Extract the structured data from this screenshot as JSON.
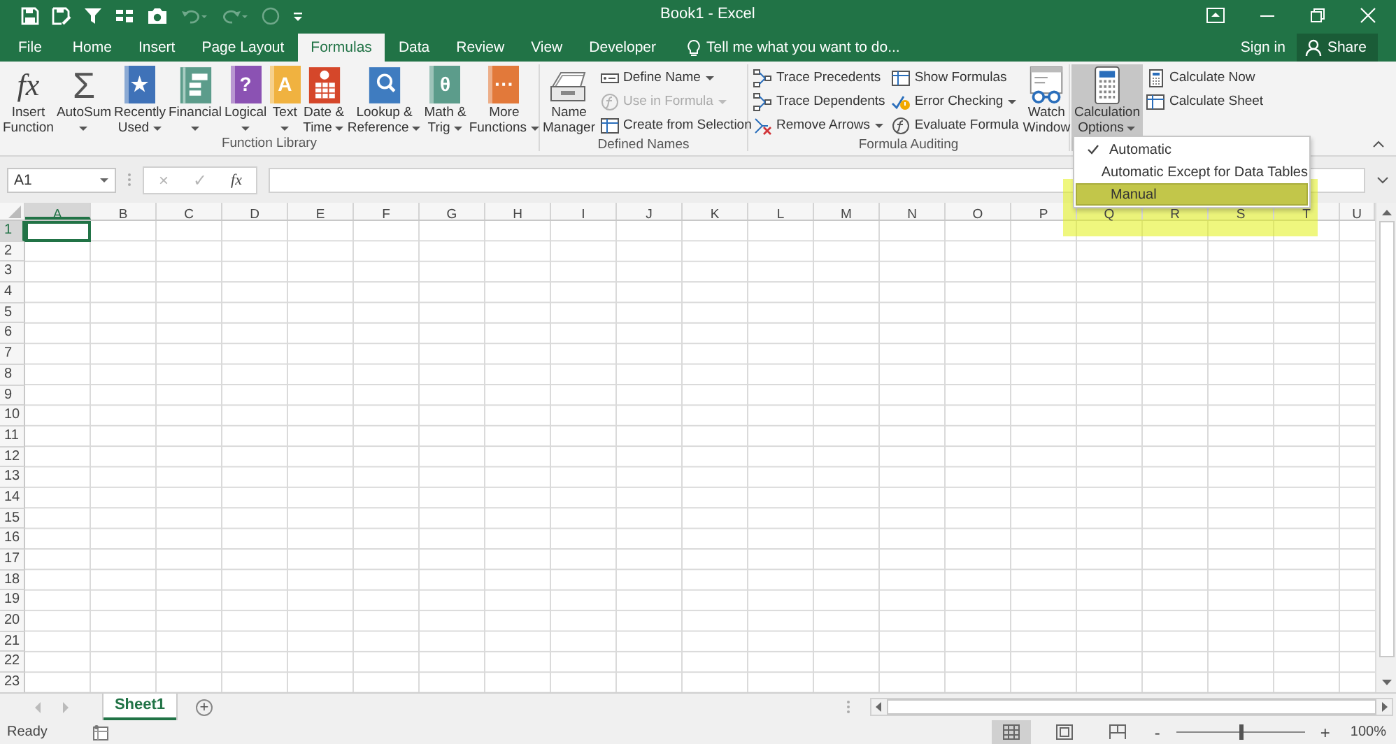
{
  "window": {
    "title": "Book1 - Excel"
  },
  "tabs": [
    {
      "label": "File",
      "selected": false
    },
    {
      "label": "Home",
      "selected": false
    },
    {
      "label": "Insert",
      "selected": false
    },
    {
      "label": "Page Layout",
      "selected": false
    },
    {
      "label": "Formulas",
      "selected": true
    },
    {
      "label": "Data",
      "selected": false
    },
    {
      "label": "Review",
      "selected": false
    },
    {
      "label": "View",
      "selected": false
    },
    {
      "label": "Developer",
      "selected": false
    }
  ],
  "tell_me": {
    "placeholder": "Tell me what you want to do..."
  },
  "sign_in": "Sign in",
  "share": "Share",
  "ribbon_groups": [
    {
      "label": "Function Library",
      "columns": [
        {
          "kind": "fx",
          "glyph": "fx",
          "lines": [
            "Insert",
            "Function"
          ],
          "dropdown": false,
          "pressed": false
        },
        {
          "kind": "sigma",
          "glyph": "Σ",
          "lines": [
            "AutoSum"
          ],
          "dropdown": true,
          "pressed": false
        },
        {
          "kind": "book",
          "glyph": "★",
          "color": "#3f72b8",
          "lines": [
            "Recently",
            "Used"
          ],
          "dropdown": true,
          "pressed": false
        },
        {
          "kind": "coins",
          "color": "#5c9c8b",
          "lines": [
            "Financial"
          ],
          "dropdown": true,
          "pressed": false
        },
        {
          "kind": "book",
          "glyph": "?",
          "color": "#8b52b3",
          "lines": [
            "Logical"
          ],
          "dropdown": true,
          "pressed": false
        },
        {
          "kind": "book",
          "glyph": "A",
          "color": "#f0b240",
          "lines": [
            "Text"
          ],
          "dropdown": true,
          "pressed": false
        },
        {
          "kind": "calendar",
          "color": "#d5472a",
          "lines": [
            "Date &",
            "Time"
          ],
          "dropdown": true,
          "pressed": false
        },
        {
          "kind": "lookup",
          "color": "#3f7cc0",
          "lines": [
            "Lookup &",
            "Reference"
          ],
          "dropdown": true,
          "pressed": false
        },
        {
          "kind": "book",
          "glyph": "θ",
          "color": "#5c9c8b",
          "lines": [
            "Math &",
            "Trig"
          ],
          "dropdown": true,
          "pressed": false
        },
        {
          "kind": "book",
          "glyph": "···",
          "color": "#e2793a",
          "lines": [
            "More",
            "Functions"
          ],
          "dropdown": true,
          "pressed": false
        }
      ]
    },
    {
      "label": "Defined Names",
      "columns": [
        {
          "kind": "name-manager",
          "lines": [
            "Name",
            "Manager"
          ],
          "dropdown": false,
          "pressed": false
        },
        {
          "items": [
            {
              "kind": "tag",
              "label": "Define Name",
              "dropdown": true,
              "disabled": false
            },
            {
              "kind": "fx-small",
              "label": "Use in Formula",
              "dropdown": true,
              "disabled": true
            },
            {
              "kind": "table",
              "label": "Create from Selection",
              "dropdown": false,
              "disabled": false
            }
          ]
        }
      ]
    },
    {
      "label": "Formula Auditing",
      "columns": [
        {
          "items": [
            {
              "kind": "precedents",
              "label": "Trace Precedents",
              "dropdown": false,
              "disabled": false
            },
            {
              "kind": "dependents",
              "label": "Trace Dependents",
              "dropdown": false,
              "disabled": false
            },
            {
              "kind": "remove-arrows",
              "label": "Remove Arrows",
              "dropdown": true,
              "disabled": false
            }
          ]
        },
        {
          "items": [
            {
              "kind": "show-formulas",
              "label": "Show Formulas",
              "dropdown": false,
              "disabled": false
            },
            {
              "kind": "error",
              "label": "Error Checking",
              "dropdown": true,
              "disabled": false
            },
            {
              "kind": "evaluate",
              "label": "Evaluate Formula",
              "dropdown": false,
              "disabled": false
            }
          ]
        },
        {
          "kind": "watch",
          "lines": [
            "Watch",
            "Window"
          ],
          "dropdown": false,
          "pressed": false
        }
      ]
    },
    {
      "columns": [
        {
          "kind": "calculator",
          "lines": [
            "Calculation",
            "Options"
          ],
          "dropdown": true,
          "pressed": true
        },
        {
          "items": [
            {
              "kind": "calc-now",
              "label": "Calculate Now",
              "dropdown": false,
              "disabled": false
            },
            {
              "kind": "calc-sheet",
              "label": "Calculate Sheet",
              "dropdown": false,
              "disabled": false
            }
          ]
        }
      ]
    }
  ],
  "calc_menu": [
    {
      "label": "Automatic",
      "checked": true,
      "selected": false
    },
    {
      "label": "Automatic Except for Data Tables",
      "checked": false,
      "selected": false
    },
    {
      "label": "Manual",
      "checked": false,
      "selected": true
    }
  ],
  "name_box": "A1",
  "formula_buttons": {
    "cancel": "×",
    "enter": "✓",
    "function": "fx"
  },
  "columns": [
    {
      "label": "A",
      "selected": true
    },
    {
      "label": "B",
      "selected": false
    },
    {
      "label": "C",
      "selected": false
    },
    {
      "label": "D",
      "selected": false
    },
    {
      "label": "E",
      "selected": false
    },
    {
      "label": "F",
      "selected": false
    },
    {
      "label": "G",
      "selected": false
    },
    {
      "label": "H",
      "selected": false
    },
    {
      "label": "I",
      "selected": false
    },
    {
      "label": "J",
      "selected": false
    },
    {
      "label": "K",
      "selected": false
    },
    {
      "label": "L",
      "selected": false
    },
    {
      "label": "M",
      "selected": false
    },
    {
      "label": "N",
      "selected": false
    },
    {
      "label": "O",
      "selected": false
    },
    {
      "label": "P",
      "selected": false
    },
    {
      "label": "Q",
      "selected": false
    },
    {
      "label": "R",
      "selected": false
    },
    {
      "label": "S",
      "selected": false
    },
    {
      "label": "T",
      "selected": false
    },
    {
      "label": "U",
      "selected": false
    }
  ],
  "rows": [
    {
      "label": "1",
      "selected": true
    },
    {
      "label": "2",
      "selected": false
    },
    {
      "label": "3",
      "selected": false
    },
    {
      "label": "4",
      "selected": false
    },
    {
      "label": "5",
      "selected": false
    },
    {
      "label": "6",
      "selected": false
    },
    {
      "label": "7",
      "selected": false
    },
    {
      "label": "8",
      "selected": false
    },
    {
      "label": "9",
      "selected": false
    },
    {
      "label": "10",
      "selected": false
    },
    {
      "label": "11",
      "selected": false
    },
    {
      "label": "12",
      "selected": false
    },
    {
      "label": "13",
      "selected": false
    },
    {
      "label": "14",
      "selected": false
    },
    {
      "label": "15",
      "selected": false
    },
    {
      "label": "16",
      "selected": false
    },
    {
      "label": "17",
      "selected": false
    },
    {
      "label": "18",
      "selected": false
    },
    {
      "label": "19",
      "selected": false
    },
    {
      "label": "20",
      "selected": false
    },
    {
      "label": "21",
      "selected": false
    },
    {
      "label": "22",
      "selected": false
    },
    {
      "label": "23",
      "selected": false
    }
  ],
  "sheets": [
    {
      "label": "Sheet1",
      "selected": true
    }
  ],
  "add_sheet": "+",
  "status": {
    "text": "Ready",
    "zoom_out": "-",
    "zoom_in": "+",
    "zoom": "100%",
    "zoom_slider": {
      "level": 0.5
    },
    "views": [
      {
        "kind": "normal",
        "selected": true
      },
      {
        "kind": "page-layout",
        "selected": false
      },
      {
        "kind": "page-break",
        "selected": false
      }
    ]
  }
}
